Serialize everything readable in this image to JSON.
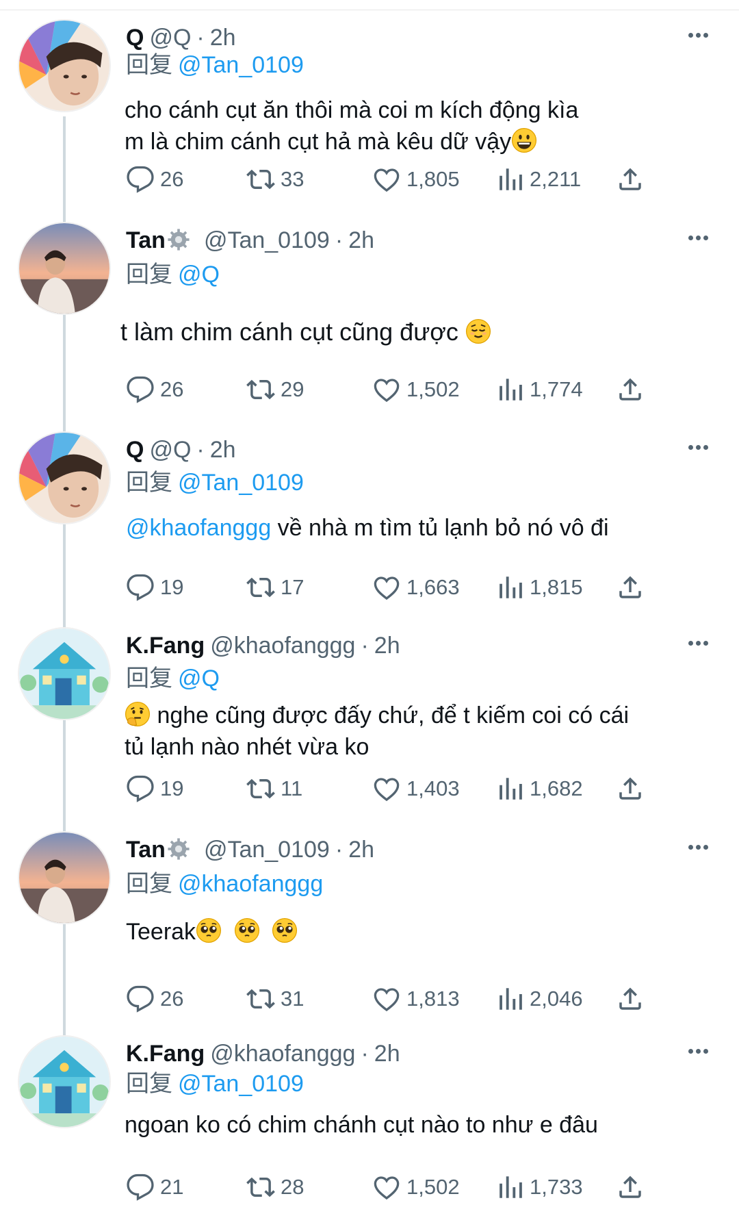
{
  "reply_prefix": "回复",
  "icons": {
    "reply": "reply-icon",
    "retweet": "retweet-icon",
    "like": "heart-icon",
    "views": "views-icon",
    "share": "share-icon",
    "more": "more-icon"
  },
  "colors": {
    "mention": "#1d9bf0",
    "muted": "#536471",
    "text": "#0f1419"
  },
  "tweets": [
    {
      "name": "Q",
      "handle": "@Q",
      "time": "2h",
      "reply_to": "@Tan_0109",
      "line1": "cho cánh cụt ăn thôi mà coi m kích động kìa",
      "line2": "m là chim cánh cụt hả mà kêu dữ vậy",
      "replies": "26",
      "retweets": "33",
      "likes": "1,805",
      "views": "2,211"
    },
    {
      "name": "Tan",
      "handle": "@Tan_0109",
      "time": "2h",
      "reply_to": "@Q",
      "line1": "t làm chim cánh cụt cũng được ",
      "replies": "26",
      "retweets": "29",
      "likes": "1,502",
      "views": "1,774"
    },
    {
      "name": "Q",
      "handle": "@Q",
      "time": "2h",
      "reply_to": "@Tan_0109",
      "mention": "@khaofanggg",
      "line1": " về nhà m tìm tủ lạnh bỏ nó vô đi",
      "replies": "19",
      "retweets": "17",
      "likes": "1,663",
      "views": "1,815"
    },
    {
      "name": "K.Fang",
      "handle": "@khaofanggg",
      "time": "2h",
      "reply_to": "@Q",
      "line1": " nghe cũng được đấy chứ, để t kiếm coi có cái",
      "line2": "tủ lạnh nào nhét vừa ko",
      "replies": "19",
      "retweets": "11",
      "likes": "1,403",
      "views": "1,682"
    },
    {
      "name": "Tan",
      "handle": "@Tan_0109",
      "time": "2h",
      "reply_to": "@khaofanggg",
      "line1": "Teerak",
      "replies": "26",
      "retweets": "31",
      "likes": "1,813",
      "views": "2,046"
    },
    {
      "name": "K.Fang",
      "handle": "@khaofanggg",
      "time": "2h",
      "reply_to": "@Tan_0109",
      "line1": "ngoan ko có chim chánh cụt nào to như e đâu",
      "replies": "21",
      "retweets": "28",
      "likes": "1,502",
      "views": "1,733"
    }
  ]
}
